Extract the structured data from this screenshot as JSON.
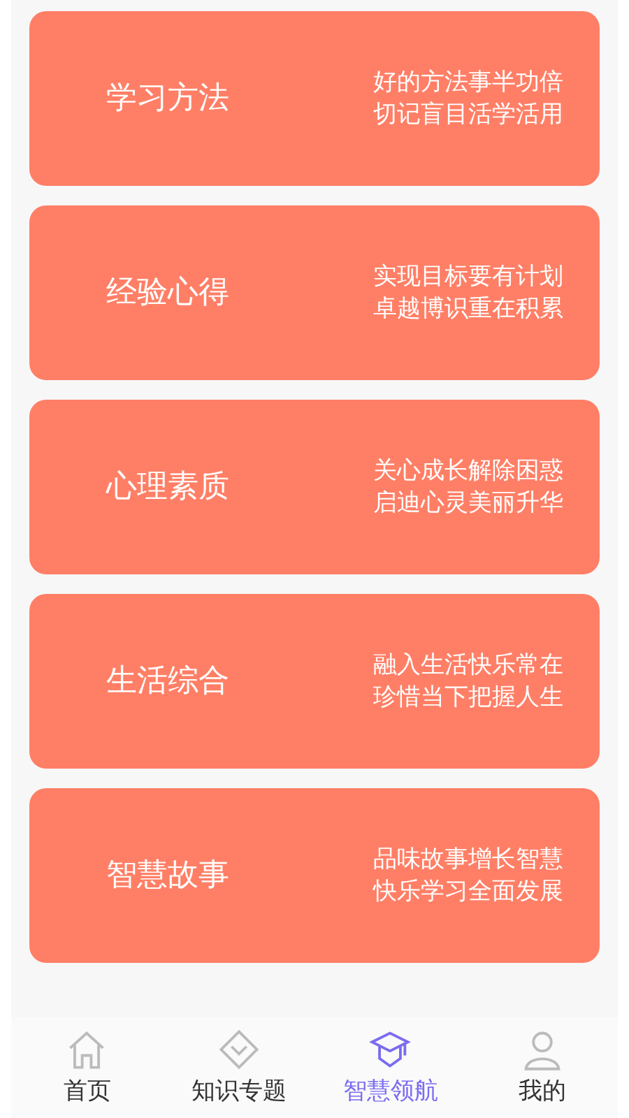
{
  "cards": [
    {
      "title": "学习方法",
      "lines": [
        "好的方法事半功倍",
        "切记盲目活学活用"
      ]
    },
    {
      "title": "经验心得",
      "lines": [
        "实现目标要有计划",
        "卓越博识重在积累"
      ]
    },
    {
      "title": "心理素质",
      "lines": [
        "关心成长解除困惑",
        "启迪心灵美丽升华"
      ]
    },
    {
      "title": "生活综合",
      "lines": [
        "融入生活快乐常在",
        "珍惜当下把握人生"
      ]
    },
    {
      "title": "智慧故事",
      "lines": [
        "品味故事增长智慧",
        "快乐学习全面发展"
      ]
    }
  ],
  "tabs": [
    {
      "label": "首页",
      "kind": "home",
      "selected": false
    },
    {
      "label": "知识专题",
      "kind": "topics",
      "selected": false
    },
    {
      "label": "智慧领航",
      "kind": "cap",
      "selected": true
    },
    {
      "label": "我的",
      "kind": "user",
      "selected": false
    }
  ]
}
